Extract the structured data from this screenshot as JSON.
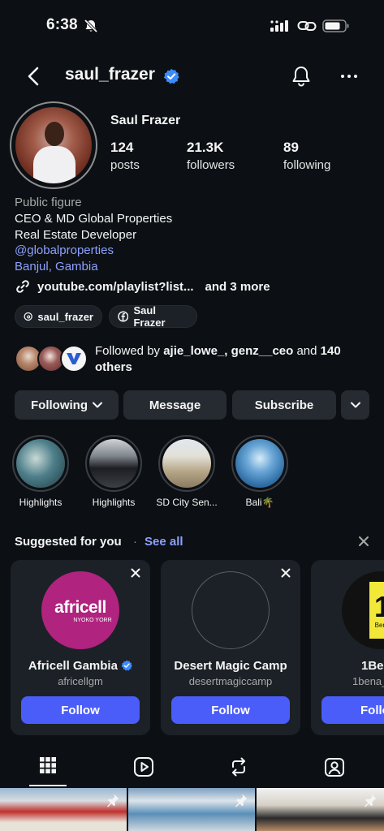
{
  "status_bar": {
    "time": "6:38"
  },
  "header": {
    "username": "saul_frazer"
  },
  "profile": {
    "full_name": "Saul Frazer",
    "stats": [
      {
        "value": "124",
        "label": "posts"
      },
      {
        "value": "21.3K",
        "label": "followers"
      },
      {
        "value": "89",
        "label": "following"
      }
    ],
    "category": "Public figure",
    "bio_lines": [
      "CEO & MD Global Properties",
      "Real Estate Developer"
    ],
    "mention": "@globalproperties",
    "location": "Banjul, Gambia",
    "link_text": "youtube.com/playlist?list...",
    "link_more": "and 3 more"
  },
  "chips": {
    "threads": "saul_frazer",
    "facebook": "Saul Frazer"
  },
  "followed_by": {
    "prefix": "Followed by ",
    "names": "ajie_lowe_, genz__ceo",
    "middle": " and ",
    "count": "140",
    "suffix": "others",
    "avatar_badge": "THE VISIBILITY"
  },
  "actions": {
    "following": "Following",
    "message": "Message",
    "subscribe": "Subscribe"
  },
  "highlights": [
    {
      "label": "Highlights",
      "color": "#4d7e8a"
    },
    {
      "label": "Highlights",
      "color": "#3c3f46"
    },
    {
      "label": "SD City Sen...",
      "color": "#b8a88a"
    },
    {
      "label": "Bali🌴",
      "color": "#2f6fa6"
    }
  ],
  "suggested": {
    "title": "Suggested for you",
    "dot": "·",
    "see_all": "See all",
    "cards": [
      {
        "name": "Africell Gambia",
        "handle": "africellgm",
        "follow": "Follow",
        "logo_text": "africell",
        "logo_sub": "NYOKO YORR",
        "logo_color": "#b0237f"
      },
      {
        "name": "Desert Magic Camp",
        "handle": "desertmagiccamp",
        "follow": "Follow"
      },
      {
        "name": "1Be",
        "handle": "1bena_",
        "follow": "Follo",
        "logo_text": "1",
        "logo_sub": "Bena"
      }
    ]
  }
}
